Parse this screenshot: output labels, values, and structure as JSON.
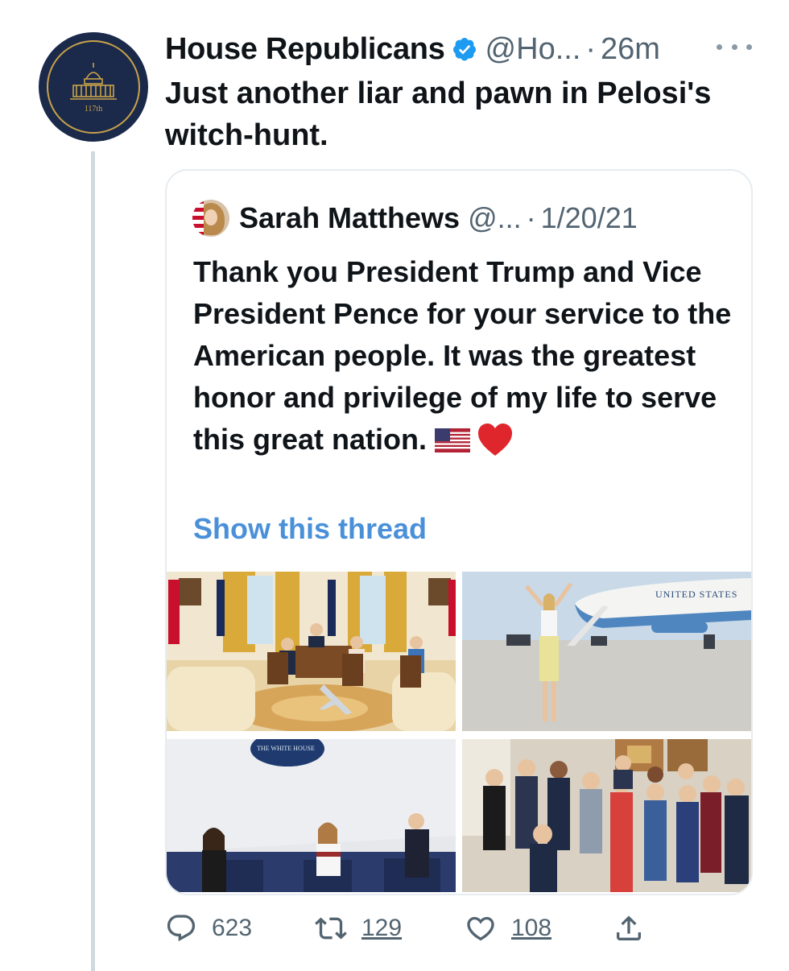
{
  "tweet": {
    "author_name": "House Republicans",
    "handle": "@Ho...",
    "separator": "·",
    "time": "26m",
    "text": "Just another liar and pawn in Pelosi's witch-hunt.",
    "avatar_text": "117th"
  },
  "quote": {
    "author_name": "Sarah Matthews",
    "handle": "@...",
    "separator": "·",
    "date": "1/20/21",
    "text": "Thank you President Trump and Vice President Pence for your service to the American people. It was the greatest honor and privilege of my life to serve this great nation.",
    "show_thread": "Show this thread",
    "photo_text_plane": "UNITED STATES",
    "photo_text_seal": "THE WHITE HOUSE"
  },
  "actions": {
    "replies": "623",
    "retweets": "129",
    "likes": "108"
  },
  "colors": {
    "verified": "#1d9bf0",
    "link": "#4a90d9",
    "muted": "#536471",
    "thread_line": "#cfd9de"
  },
  "icons": [
    "verified-badge-icon",
    "more-icon",
    "reply-icon",
    "retweet-icon",
    "like-icon",
    "share-icon",
    "us-flag-emoji",
    "red-heart-emoji"
  ]
}
